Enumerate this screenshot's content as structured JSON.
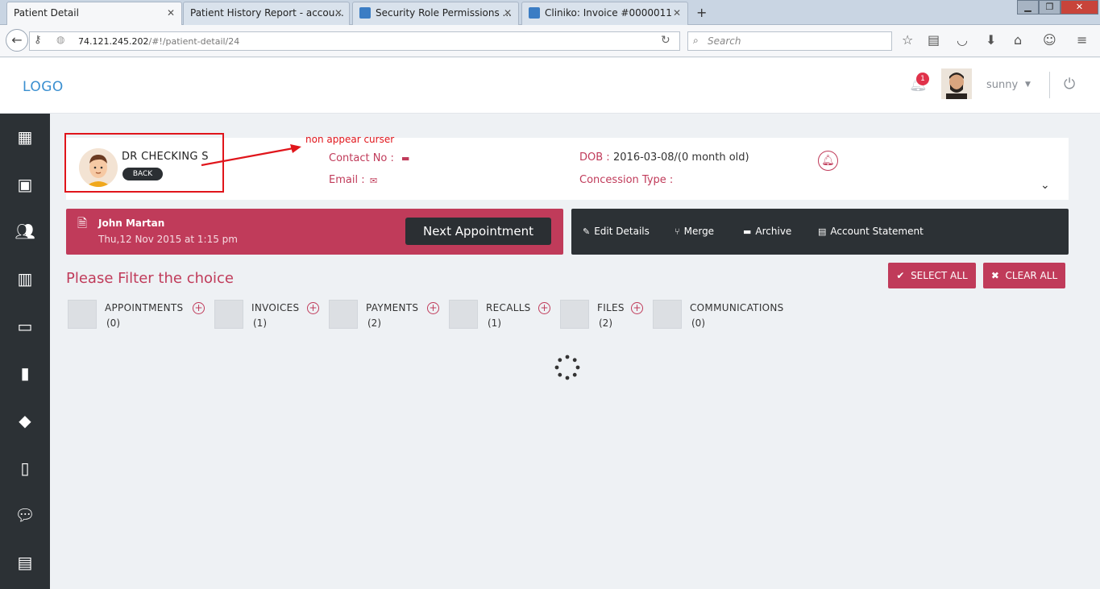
{
  "browser": {
    "tabs": [
      {
        "title": "Patient Detail"
      },
      {
        "title": "Patient History Report - accou..."
      },
      {
        "title": "Security Role Permissions ..."
      },
      {
        "title": "Cliniko: Invoice #0000011"
      }
    ],
    "url_host": "74.121.245.202",
    "url_path": "/#!/patient-detail/24",
    "search_placeholder": "Search"
  },
  "header": {
    "logo": "LOGO",
    "notification_count": "1",
    "username": "sunny"
  },
  "patient": {
    "name": "DR CHECKING S",
    "back_label": "BACK",
    "contact_label": "Contact No :",
    "email_label": "Email :",
    "dob_label": "DOB :",
    "dob_value": "2016-03-08/(0 month old)",
    "concession_label": "Concession Type :"
  },
  "annotation": "non appear curser",
  "appointment": {
    "name": "John Martan",
    "datetime": "Thu,12 Nov 2015 at 1:15 pm",
    "next_label": "Next Appointment"
  },
  "actions": {
    "edit": "Edit Details",
    "merge": "Merge",
    "archive": "Archive",
    "statement": "Account Statement"
  },
  "filter": {
    "title": "Please Filter the choice",
    "select_all": "SELECT ALL",
    "clear_all": "CLEAR ALL",
    "categories": [
      {
        "label": "APPOINTMENTS",
        "count": "(0)"
      },
      {
        "label": "INVOICES",
        "count": "(1)"
      },
      {
        "label": "PAYMENTS",
        "count": "(2)"
      },
      {
        "label": "RECALLS",
        "count": "(1)"
      },
      {
        "label": "FILES",
        "count": "(2)"
      },
      {
        "label": "COMMUNICATIONS",
        "count": "(0)"
      }
    ]
  },
  "colors": {
    "accent": "#c03b5a",
    "sidebar": "#2c3135",
    "logo": "#3a8fd0",
    "annotation": "#e0151b"
  }
}
